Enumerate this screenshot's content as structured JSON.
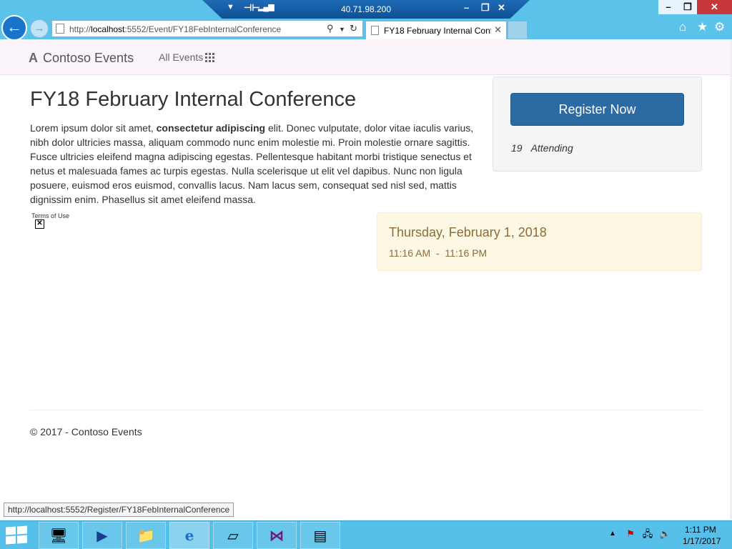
{
  "browser": {
    "rdp_host": "40.71.98.200",
    "address_url_prefix": "http://",
    "address_url_host": "localhost",
    "address_url_rest": ":5552/Event/FY18FebInternalConference",
    "tab_title": "FY18 February Internal Conf...",
    "status_url": "http://localhost:5552/Register/FY18FebInternalConference"
  },
  "navbar": {
    "brand": "Contoso Events",
    "all_events": "All Events"
  },
  "event": {
    "title": "FY18 February Internal Conference",
    "description_start": "Lorem ipsum dolor sit amet, ",
    "description_bold": "consectetur adipiscing",
    "description_end": " elit. Donec vulputate, dolor vitae iaculis varius, nibh dolor ultricies massa, aliquam commodo nunc enim molestie mi. Proin molestie ornare sagittis. Fusce ultricies eleifend magna adipiscing egestas. Pellentesque habitant morbi tristique senectus et netus et malesuada fames ac turpis egestas. Nulla scelerisque ut elit vel dapibus. Nunc non ligula posuere, euismod eros euismod, convallis lacus. Nam lacus sem, consequat sed nisl sed, mattis dignissim enim. Phasellus sit amet eleifend massa.",
    "terms_link": "Terms of Use",
    "register_label": "Register Now",
    "attending_count": "19",
    "attending_label": "Attending",
    "date": "Thursday, February 1, 2018",
    "time": "11:16 AM  -  11:16 PM"
  },
  "footer": {
    "copyright": "© 2017 - Contoso Events"
  },
  "taskbar": {
    "clock_time": "1:11 PM",
    "clock_date": "1/17/2017"
  },
  "colors": {
    "chrome_blue": "#5bc3ea",
    "register_button": "#2b6aa3",
    "date_panel_bg": "#fcf8e3",
    "date_text": "#8a6d3b",
    "navbar_bg": "#fbf4fb"
  }
}
